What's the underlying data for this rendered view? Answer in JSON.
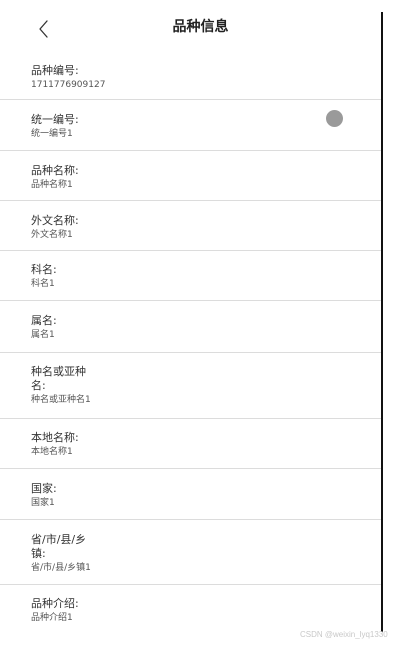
{
  "header": {
    "back_icon": "chevron-left-icon",
    "title": "品种信息"
  },
  "fields": [
    {
      "label": "品种编号:",
      "value": "1711776909127"
    },
    {
      "label": "统一编号:",
      "value": "统一编号1",
      "indicator_color": "#9a9a9a"
    },
    {
      "label": "品种名称:",
      "value": "品种名称1"
    },
    {
      "label": "外文名称:",
      "value": "外文名称1"
    },
    {
      "label": "科名:",
      "value": "科名1"
    },
    {
      "label": "属名:",
      "value": "属名1"
    },
    {
      "label": "种名或亚种\n名:",
      "value": "种名或亚种名1"
    },
    {
      "label": "本地名称:",
      "value": "本地名称1"
    },
    {
      "label": "国家:",
      "value": "国家1"
    },
    {
      "label": "省/市/县/乡\n镇:",
      "value": "省/市/县/乡镇1"
    },
    {
      "label": "品种介绍:",
      "value": "品种介绍1"
    }
  ],
  "watermark": "CSDN @weixin_lyq1330"
}
